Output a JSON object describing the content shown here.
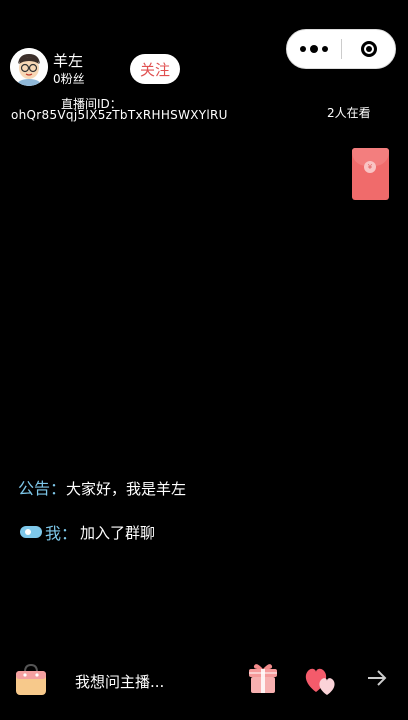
{
  "host": {
    "name": "羊左",
    "fans": "0粉丝",
    "follow_label": "关注"
  },
  "room": {
    "label": "直播间ID：",
    "id": "ohQr85Vqj5IX5zTbTxRHHSWXYlRU",
    "viewers": "2人在看"
  },
  "messages": {
    "announce_label": "公告：",
    "announce_text": "大家好，我是羊左",
    "user_label": "我：",
    "user_text": "加入了群聊"
  },
  "bottom_bar": {
    "input_placeholder": "我想问主播..."
  },
  "icons": [
    "more-icon",
    "close-icon",
    "avatar",
    "red-packet-icon",
    "user-badge-icon",
    "shopping-bag-icon",
    "gift-icon",
    "hearts-icon",
    "arrow-right-icon"
  ],
  "colors": {
    "background": "#000000",
    "accent_blue": "#7ec8ea",
    "follow_red": "#e05050",
    "red_packet": "#f06b6b"
  }
}
